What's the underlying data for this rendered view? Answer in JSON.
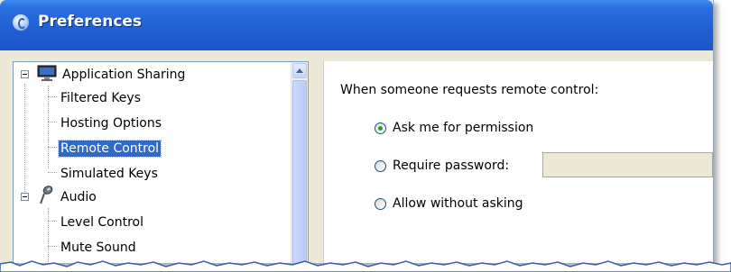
{
  "window": {
    "title": "Preferences",
    "title_color": "#1f5ed3"
  },
  "tree": {
    "items": [
      {
        "label": "Application Sharing",
        "level": 0,
        "expanded": true,
        "icon": "monitor-icon"
      },
      {
        "label": "Filtered Keys",
        "level": 1
      },
      {
        "label": "Hosting Options",
        "level": 1
      },
      {
        "label": "Remote Control",
        "level": 1,
        "selected": true
      },
      {
        "label": "Simulated Keys",
        "level": 1
      },
      {
        "label": "Audio",
        "level": 0,
        "expanded": true,
        "icon": "microphone-icon"
      },
      {
        "label": "Level Control",
        "level": 1
      },
      {
        "label": "Mute Sound",
        "level": 1
      }
    ]
  },
  "panel": {
    "prompt": "When someone requests remote control:",
    "options": [
      {
        "label": "Ask me for permission",
        "checked": true
      },
      {
        "label": "Require password:",
        "checked": false
      },
      {
        "label": "Allow without asking",
        "checked": false
      }
    ],
    "password_value": ""
  },
  "colors": {
    "selection": "#316ac5",
    "radio_checked": "#21a121"
  }
}
